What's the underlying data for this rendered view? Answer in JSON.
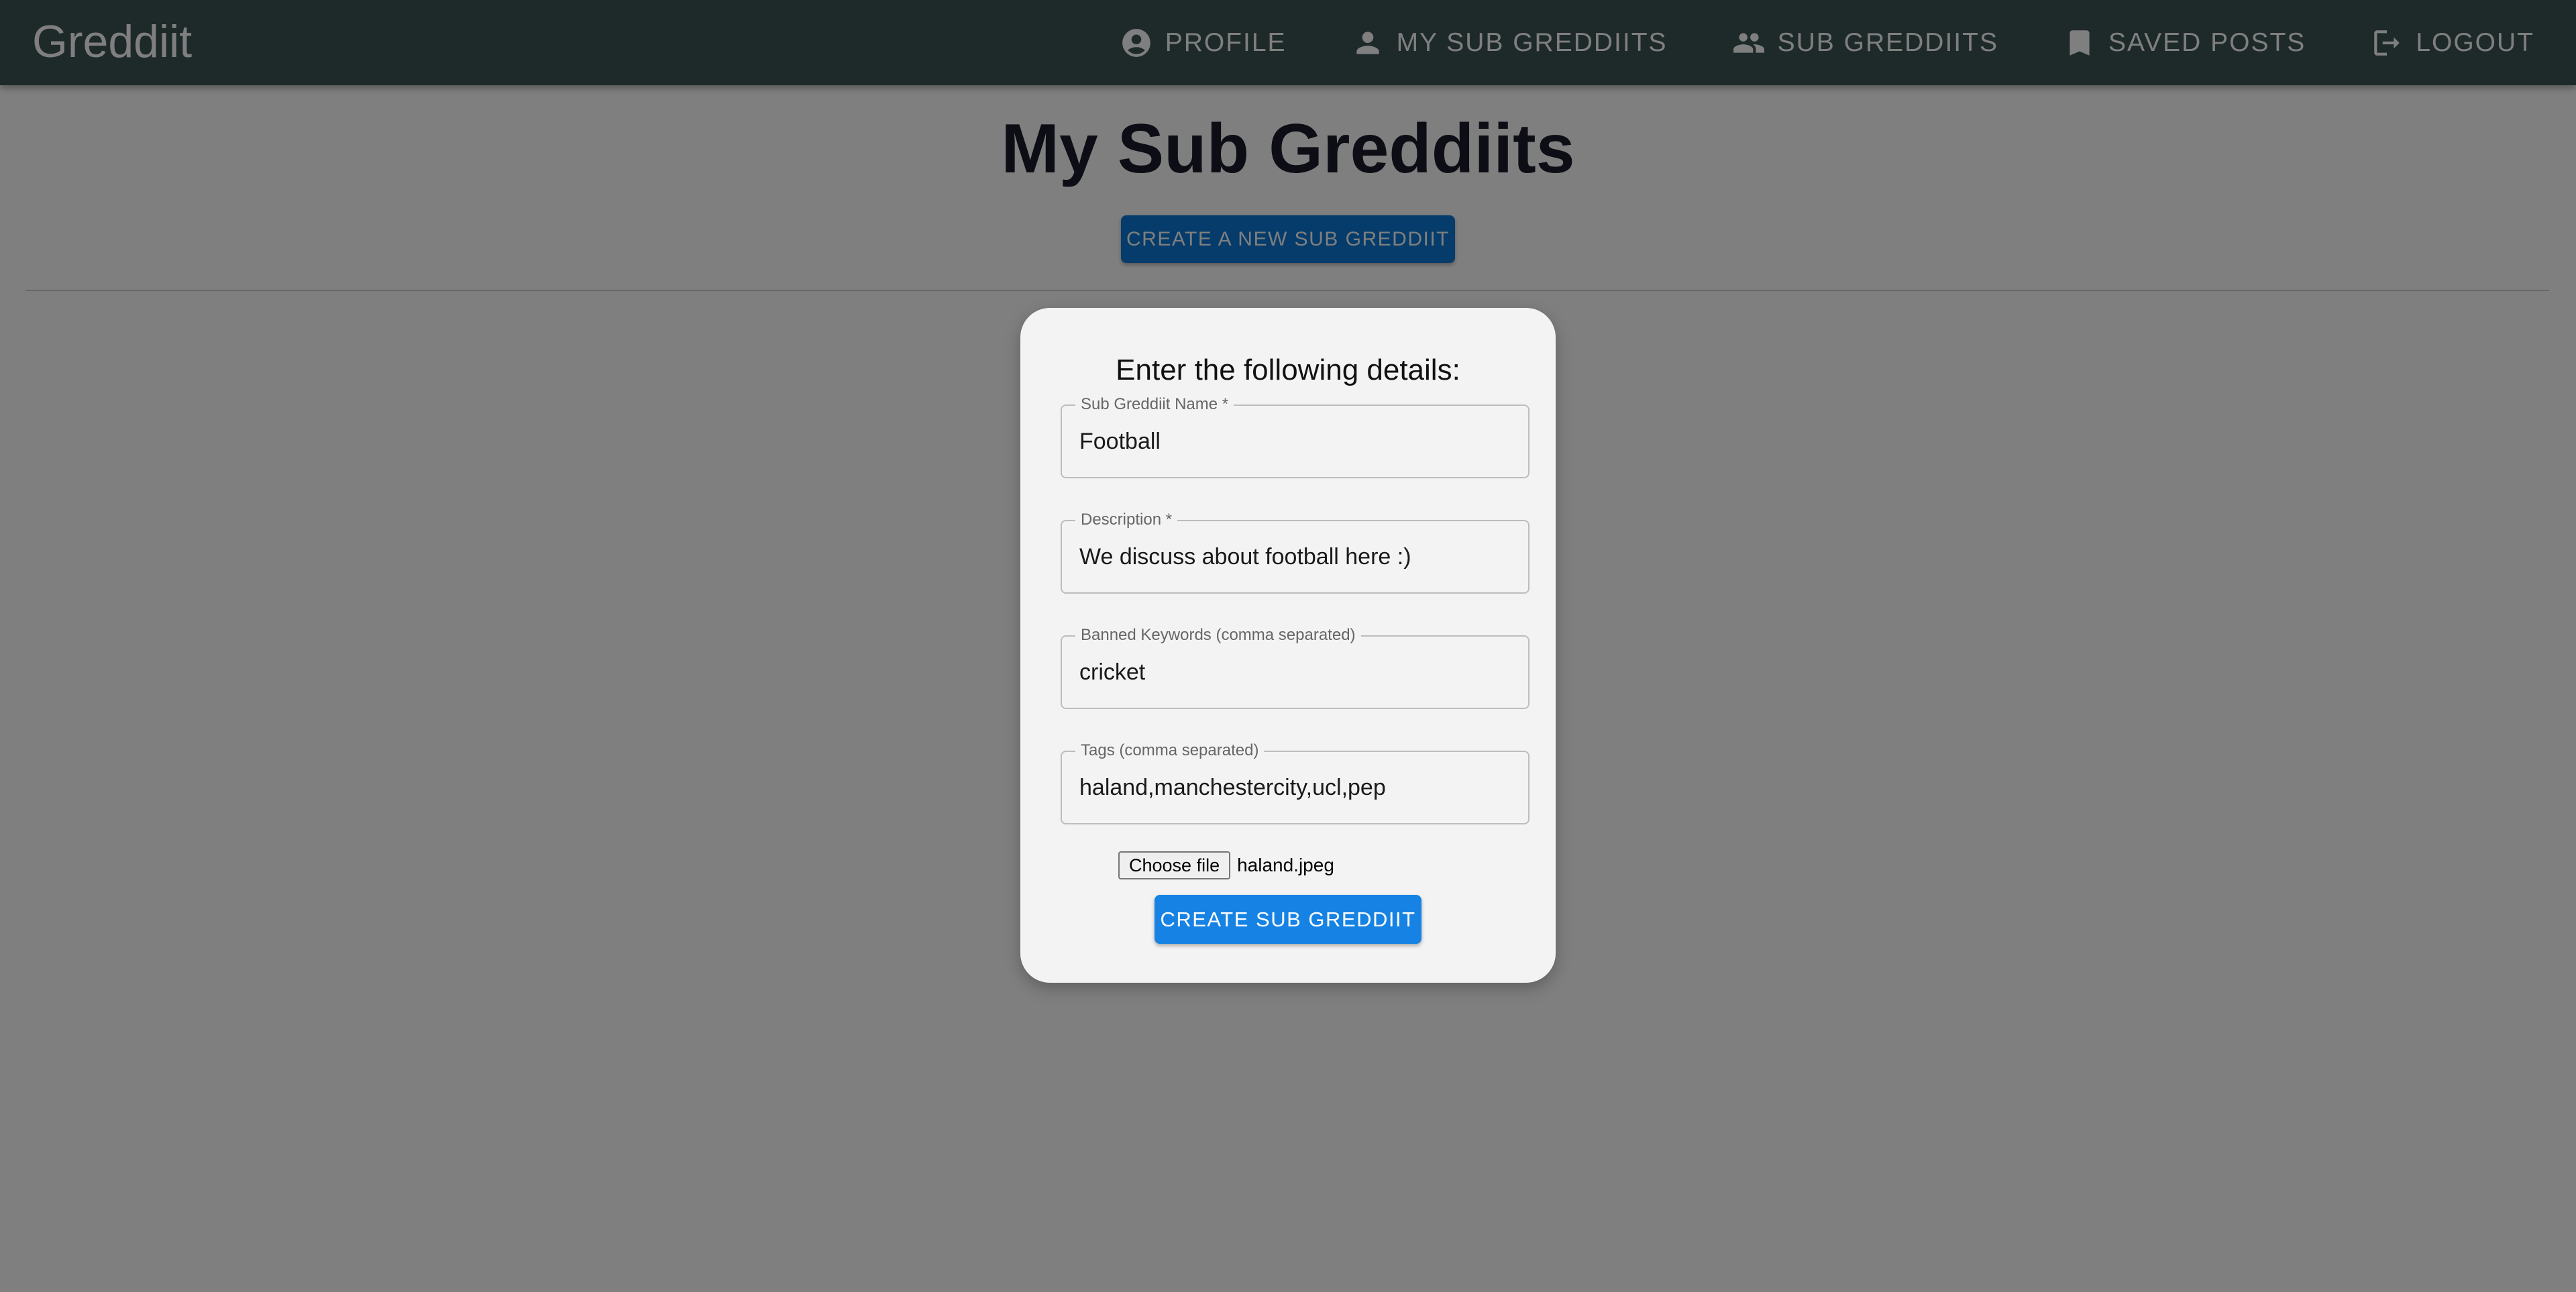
{
  "app": {
    "brand": "Greddiit"
  },
  "nav": {
    "items": [
      {
        "label": "PROFILE",
        "icon": "account-circle-icon"
      },
      {
        "label": "MY SUB GREDDIITS",
        "icon": "person-icon"
      },
      {
        "label": "SUB GREDDIITS",
        "icon": "people-icon"
      },
      {
        "label": "SAVED POSTS",
        "icon": "bookmark-icon"
      },
      {
        "label": "LOGOUT",
        "icon": "logout-icon"
      }
    ]
  },
  "page": {
    "title": "My Sub Greddiits",
    "create_button_label": "CREATE A NEW SUB GREDDIIT"
  },
  "modal": {
    "heading": "Enter the following details:",
    "fields": [
      {
        "label": "Sub Greddiit Name *",
        "value": "Football"
      },
      {
        "label": "Description *",
        "value": "We discuss about football here :)"
      },
      {
        "label": "Banned Keywords (comma separated)",
        "value": "cricket"
      },
      {
        "label": "Tags (comma separated)",
        "value": "haland,manchestercity,ucl,pep"
      }
    ],
    "file": {
      "button_label": "Choose file",
      "file_name": "haland.jpeg"
    },
    "submit_label": "CREATE SUB GREDDIIT"
  },
  "colors": {
    "appbar": "#3c5453",
    "primary_button": "#1683e4",
    "modal_background": "#f3f3f3"
  }
}
